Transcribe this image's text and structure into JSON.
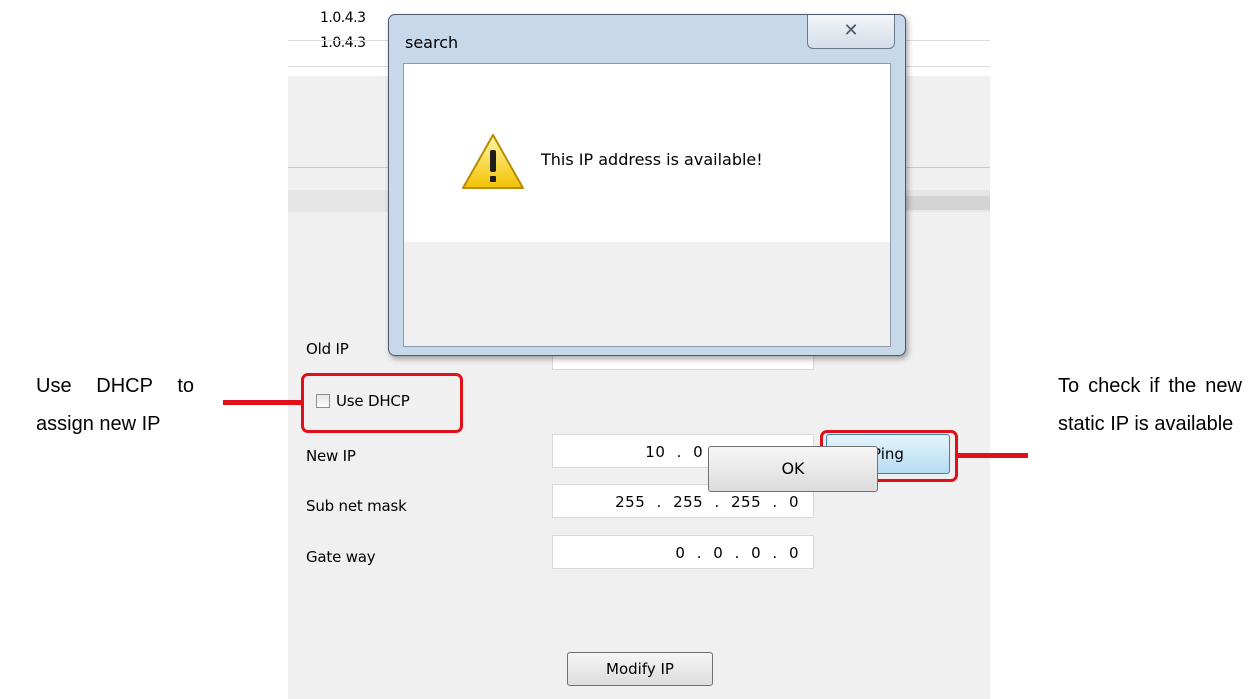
{
  "background_list": {
    "rows": [
      "1.0.4.3",
      "1.0.4.3"
    ]
  },
  "form": {
    "old_ip_label": "Old IP",
    "use_dhcp_label": "Use DHCP",
    "use_dhcp_checked": false,
    "new_ip_label": "New IP",
    "new_ip_value": "10 . 0 . 0 . 199",
    "subnet_label": "Sub net mask",
    "subnet_value": "255 . 255 . 255 . 0",
    "gateway_label": "Gate way",
    "gateway_value": "0 . 0 . 0 . 0",
    "ping_label": "Ping",
    "modify_label": "Modify IP"
  },
  "dialog": {
    "title": "search",
    "close_glyph": "✕",
    "message": "This IP address is available!",
    "ok_label": "OK",
    "icon": "warning-icon"
  },
  "annotations": {
    "left_text": "Use DHCP to assign new IP",
    "right_text": "To check if the new static IP is available",
    "highlight_color": "#e0101a"
  }
}
